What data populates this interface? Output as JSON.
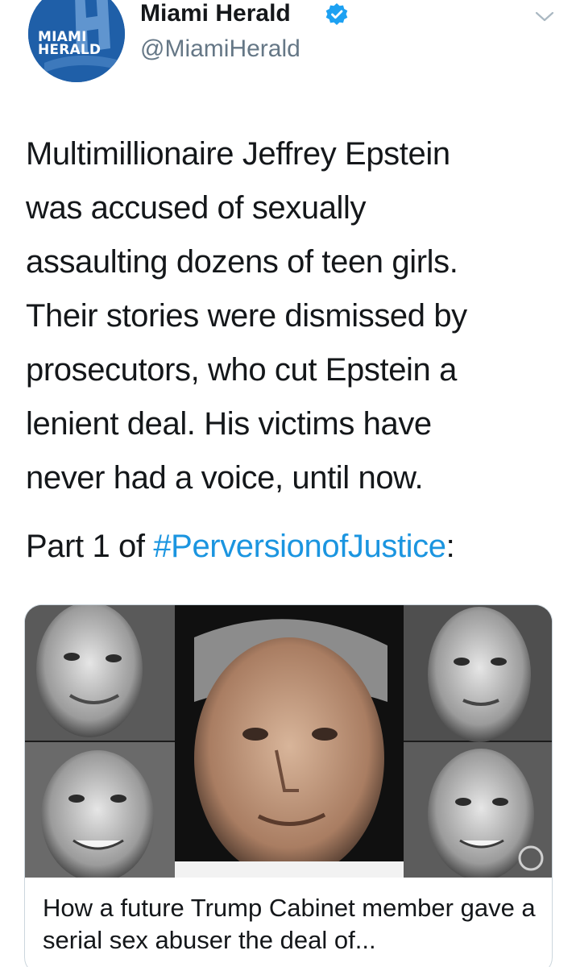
{
  "header": {
    "avatar": {
      "line1": "MIAMI",
      "line2": "HERALD",
      "color": "#1f5fa8"
    },
    "display_name": "Miami Herald",
    "verified_icon": "verified-badge-icon",
    "handle": "@MiamiHerald",
    "menu_icon": "chevron-down-icon"
  },
  "tweet": {
    "lines": [
      "Multimillionaire Jeffrey Epstein",
      "was accused of sexually",
      "assaulting dozens of teen girls.",
      "Their stories were dismissed by",
      "prosecutors, who cut Epstein a",
      "lenient deal. His victims have",
      "never had a voice, until now."
    ],
    "part_prefix": "Part 1 of ",
    "hashtag": "#PerversionofJustice",
    "part_suffix": ":"
  },
  "card": {
    "image_icon": "news-photo-collage-image",
    "title": "How a future Trump Cabinet member gave a serial sex abuser the deal of..."
  },
  "colors": {
    "text": "#14171a",
    "secondary": "#657786",
    "link": "#1b95e0",
    "verified": "#1da1f2"
  }
}
